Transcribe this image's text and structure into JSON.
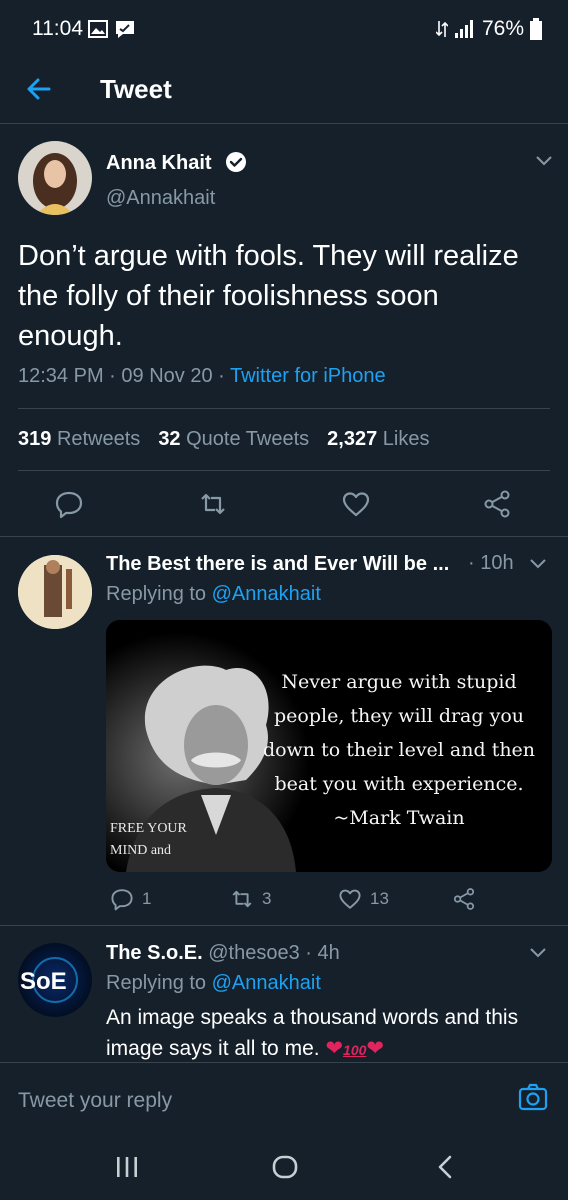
{
  "status": {
    "time": "11:04",
    "battery": "76%"
  },
  "header": {
    "title": "Tweet"
  },
  "main_tweet": {
    "name": "Anna Khait",
    "handle": "@Annakhait",
    "text": "Don’t argue with fools. They will realize the folly of their foolishness soon enough.",
    "time": "12:34 PM",
    "sep1": " · ",
    "date": "09 Nov 20",
    "sep2": " · ",
    "source": "Twitter for iPhone",
    "stats": {
      "retweets_count": "319",
      "retweets_label": "Retweets",
      "quotes_count": "32",
      "quotes_label": "Quote Tweets",
      "likes_count": "2,327",
      "likes_label": "Likes"
    }
  },
  "replies": [
    {
      "name": "The Best there is and Ever Will be ...",
      "age": "· 10h",
      "replying_prefix": "Replying to",
      "replying_to": "@Annakhait",
      "image_quote": "Never argue with stupid people, they will drag you down to their level and then beat you with experience. ~Mark Twain",
      "image_side_text": "FREE YOUR MIND and",
      "reply_count": "1",
      "retweet_count": "3",
      "like_count": "13"
    },
    {
      "name": "The S.o.E.",
      "handle_age": "@thesoe3 · 4h",
      "replying_prefix": "Replying to",
      "replying_to": "@Annakhait",
      "text": "An image speaks a thousand words and this image says it all to me.",
      "avatar_text": "SoE"
    }
  ],
  "reply_bar": {
    "placeholder": "Tweet your reply"
  },
  "colors": {
    "background": "#15202b",
    "accent": "#1da1f2",
    "muted": "#8899a6",
    "divider": "#38444d"
  }
}
